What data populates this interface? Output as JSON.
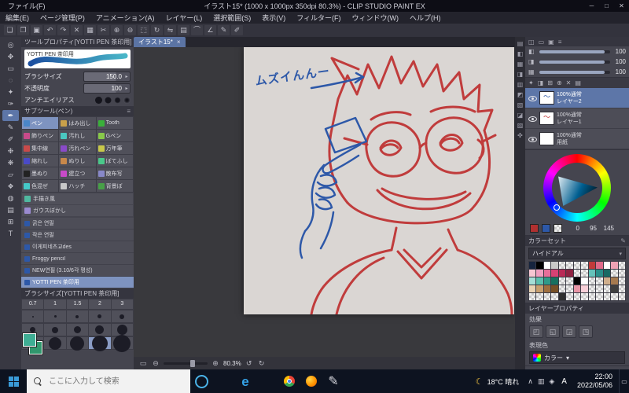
{
  "window": {
    "menu_file": "ファイル(F)",
    "title": "イラスト15* (1000 x 1000px 350dpi 80.3%) - CLIP STUDIO PAINT EX",
    "minimize": "─",
    "maximize": "□",
    "close": "✕"
  },
  "menubar": {
    "items": [
      "編集(E)",
      "ページ管理(P)",
      "アニメーション(A)",
      "レイヤー(L)",
      "選択範囲(S)",
      "表示(V)",
      "フィルター(F)",
      "ウィンドウ(W)",
      "ヘルプ(H)"
    ]
  },
  "toolbar": {
    "icons": [
      {
        "name": "new-file",
        "glyph": "❏"
      },
      {
        "name": "open-file",
        "glyph": "❐"
      },
      {
        "name": "save-file",
        "glyph": "▣"
      },
      {
        "name": "undo",
        "glyph": "↶"
      },
      {
        "name": "redo",
        "glyph": "↷"
      },
      {
        "name": "delete",
        "glyph": "✕"
      },
      {
        "name": "deselect",
        "glyph": "▦"
      },
      {
        "name": "crop",
        "glyph": "✂"
      },
      {
        "name": "zoom-in",
        "glyph": "⊕"
      },
      {
        "name": "zoom-out",
        "glyph": "⊖"
      },
      {
        "name": "fit-screen",
        "glyph": "⬚"
      },
      {
        "name": "rotate-view",
        "glyph": "↻"
      },
      {
        "name": "flip-horizontal",
        "glyph": "⇋"
      },
      {
        "name": "grid",
        "glyph": "▤"
      },
      {
        "name": "ruler",
        "glyph": "⌒"
      },
      {
        "name": "snap",
        "glyph": "∠"
      },
      {
        "name": "correction-line",
        "glyph": "✎"
      },
      {
        "name": "correction-curve",
        "glyph": "✐"
      }
    ]
  },
  "toolstrip": {
    "tools": [
      {
        "name": "zoom-tool",
        "glyph": "◎"
      },
      {
        "name": "move-tool",
        "glyph": "✥"
      },
      {
        "name": "operation-tool",
        "glyph": "▭"
      },
      {
        "name": "selection-tool",
        "glyph": "◌"
      },
      {
        "name": "auto-select-tool",
        "glyph": "✦"
      },
      {
        "name": "eyedropper-tool",
        "glyph": "✑"
      },
      {
        "name": "pen-tool",
        "glyph": "✒",
        "selected": true
      },
      {
        "name": "pencil-tool",
        "glyph": "✎"
      },
      {
        "name": "brush-tool",
        "glyph": "✐"
      },
      {
        "name": "airbrush-tool",
        "glyph": "❉"
      },
      {
        "name": "decoration-tool",
        "glyph": "❋"
      },
      {
        "name": "eraser-tool",
        "glyph": "▱"
      },
      {
        "name": "blend-tool",
        "glyph": "❖"
      },
      {
        "name": "fill-tool",
        "glyph": "◍"
      },
      {
        "name": "gradient-tool",
        "glyph": "▤"
      },
      {
        "name": "figure-tool",
        "glyph": "⊞"
      },
      {
        "name": "text-tool",
        "glyph": "T"
      }
    ]
  },
  "tool_property": {
    "title": "ツールプロパティ[YOTTI PEN 茶印用]",
    "preset_name": "YOTTI PEN 茶印用",
    "params": [
      {
        "label": "ブラシサイズ",
        "value": "150.0"
      },
      {
        "label": "不透明度",
        "value": "100"
      }
    ],
    "antialias_label": "アンチエイリアス"
  },
  "subtool": {
    "title": "サブツール(ペン)",
    "grid": [
      {
        "label": "ペン",
        "color": "#4a86c8",
        "selected": true
      },
      {
        "label": "はみ出し",
        "color": "#c8a04a"
      },
      {
        "label": "Tooth",
        "color": "#3ab03a"
      },
      {
        "label": "飾りペン",
        "color": "#c84a8a"
      },
      {
        "label": "汚れし",
        "color": "#4ac8c0"
      },
      {
        "label": "Gペン",
        "color": "#88c84a"
      },
      {
        "label": "集中線",
        "color": "#c84a4a"
      },
      {
        "label": "汚れペン",
        "color": "#8a4ac8"
      },
      {
        "label": "万年筆",
        "color": "#c8c84a"
      },
      {
        "label": "縮れし",
        "color": "#4a4ac8"
      },
      {
        "label": "ぬりし",
        "color": "#c8884a"
      },
      {
        "label": "ぼてふし",
        "color": "#4ac88a"
      },
      {
        "label": "墨ぬり",
        "color": "#222222"
      },
      {
        "label": "建立つ",
        "color": "#c84ac8"
      },
      {
        "label": "散布写",
        "color": "#8888c8"
      },
      {
        "label": "色混ぜ",
        "color": "#44c8c8"
      },
      {
        "label": "ハッチ",
        "color": "#c8c8c8"
      },
      {
        "label": "背景ぼ",
        "color": "#48a048"
      }
    ],
    "wide": [
      {
        "label": "手描き風",
        "color": "#50b8a0"
      },
      {
        "label": "ガウスぼかし",
        "color": "#9a8ad0"
      }
    ],
    "list": [
      {
        "label": "굵은 연필"
      },
      {
        "label": "작은 연필"
      },
      {
        "label": "이게피네츠교des"
      },
      {
        "label": "Froggy pencil"
      },
      {
        "label": "NEW연필 (3.10/6각 평성)"
      },
      {
        "label": "YOTTI PEN 茶印用",
        "selected": true
      }
    ]
  },
  "brush_size": {
    "title": "ブラシサイズ[YOTTI PEN 茶印用]",
    "labels": [
      "0.7",
      "1",
      "1.5",
      "2",
      "3"
    ],
    "dot_rows": [
      [
        2,
        3,
        4,
        5,
        6
      ],
      [
        7,
        8,
        9,
        11,
        13
      ],
      [
        14,
        16,
        18,
        20,
        22
      ]
    ],
    "selected_row": 2,
    "selected_col": 3
  },
  "canvas": {
    "tab_title": "イラスト15*",
    "tab_close": "×",
    "zoom_value": "80.3",
    "zoom_unit": "%",
    "annotation": "ムズイんんー",
    "ink_red": "#bf3434",
    "ink_blue": "#2d58a8",
    "icon_fit": "▭",
    "icon_zoom_out": "⊖",
    "icon_zoom_in": "⊕",
    "icon_rotate_left": "↺",
    "icon_rotate_right": "↻"
  },
  "dock_icons": [
    {
      "name": "quick-access-panel",
      "glyph": "▤"
    },
    {
      "name": "subview-panel",
      "glyph": "◧"
    },
    {
      "name": "navigator-panel",
      "glyph": "▦"
    },
    {
      "name": "information-panel",
      "glyph": "◨"
    },
    {
      "name": "history-panel",
      "glyph": "▥"
    },
    {
      "name": "material-panel",
      "glyph": "◩"
    },
    {
      "name": "auto-action-panel",
      "glyph": "▧"
    },
    {
      "name": "tone-panel",
      "glyph": "◪"
    },
    {
      "name": "search-panel",
      "glyph": "▨"
    },
    {
      "name": "timeline-panel",
      "glyph": "✜"
    }
  ],
  "quick_panel": {
    "header_icons": [
      "◫",
      "▭",
      "▣",
      "≡"
    ],
    "rows": [
      {
        "glyph": "◧",
        "value": "100"
      },
      {
        "glyph": "◨",
        "value": "100"
      },
      {
        "glyph": "▦",
        "value": "100"
      }
    ]
  },
  "layers": {
    "toolbar_icons": [
      "✦",
      "◨",
      "⊞",
      "⊕",
      "✕",
      "▤"
    ],
    "rows": [
      {
        "mode": "100%通常",
        "name": "レイヤー2",
        "selected": true,
        "thumb": "blue"
      },
      {
        "mode": "100%通常",
        "name": "レイヤー1",
        "thumb": "red"
      },
      {
        "mode": "100%通常",
        "name": "用紙",
        "thumb": "white"
      }
    ]
  },
  "color": {
    "r": "0",
    "g": "95",
    "b": "145",
    "current": "#005f91",
    "chip_main": "#b03030",
    "chip_sub": "#2d58a8",
    "strip_main": "#3fae94",
    "strip_sub": "#31976d"
  },
  "color_set": {
    "title": "カラーセット",
    "set_name": "ハイドアル",
    "swatches": [
      [
        "#16243e",
        "#000000",
        "#ffffff",
        "#c9c9c9",
        "T",
        "T",
        "T",
        "T",
        "#c23a3a",
        "#e06a8a",
        "#ffffff",
        "#efa2b4",
        "T"
      ],
      [
        "#f6c6d2",
        "#ef9fc0",
        "#e66f9a",
        "#d64274",
        "#b92a56",
        "#8e2342",
        "T",
        "T",
        "#65c2ba",
        "#2a8f8a",
        "#186a64",
        "T",
        "T"
      ],
      [
        "#a5ded6",
        "#5cbfae",
        "#2f9a88",
        "#17705f",
        "T",
        "T",
        "#000000",
        "#ffffff",
        "T",
        "T",
        "#cfae8c",
        "#a67a4f",
        "T"
      ],
      [
        "#e9d2b2",
        "#c79f6e",
        "#9e6f3f",
        "#775026",
        "T",
        "T",
        "#e895a6",
        "#f7cfd8",
        "T",
        "T",
        "T",
        "#3f3f3f",
        "T"
      ],
      [
        "T",
        "T",
        "T",
        "T",
        "#2e2e2e",
        "T",
        "T",
        "T",
        "T",
        "T",
        "T",
        "T",
        "T"
      ]
    ]
  },
  "layer_property": {
    "title": "レイヤープロパティ",
    "effect_label": "効果",
    "effect_icons": [
      "◰",
      "◱",
      "◲",
      "◳"
    ],
    "expression_label": "表現色",
    "expression_value": "カラー"
  },
  "taskbar": {
    "search_placeholder": "ここに入力して検索",
    "apps": [
      {
        "name": "cortana"
      },
      {
        "name": "task-view"
      },
      {
        "name": "edge",
        "glyph": "e"
      },
      {
        "name": "file-explorer"
      },
      {
        "name": "chrome"
      },
      {
        "name": "firefox"
      },
      {
        "name": "clip-studio",
        "glyph": "✎"
      }
    ],
    "weather_icon": "☾",
    "weather": "18°C 晴れ",
    "tray_icons": [
      "∧",
      "▥",
      "◈"
    ],
    "ime": "A",
    "time": "22:00",
    "date": "2022/05/06",
    "notification_icon": "▭"
  }
}
